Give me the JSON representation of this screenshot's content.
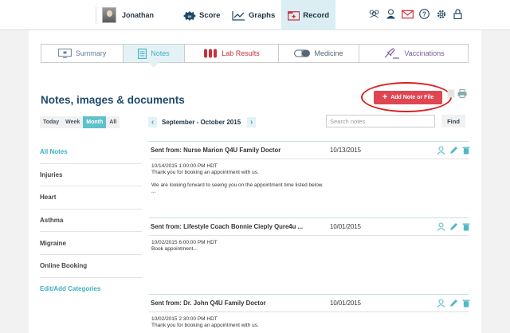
{
  "header": {
    "user_name": "Jonathan",
    "nav": [
      {
        "label": "Score",
        "icon": "score-badge-icon"
      },
      {
        "label": "Graphs",
        "icon": "line-chart-icon"
      },
      {
        "label": "Record",
        "icon": "record-folder-icon"
      }
    ],
    "active_nav": "Record",
    "right_icons": [
      "group-icon",
      "person-icon",
      "mail-icon",
      "help-icon",
      "gear-icon",
      "lock-icon"
    ]
  },
  "tabs": [
    {
      "label": "Summary",
      "icon": "summary-monitor-icon",
      "color": "#6a7f99"
    },
    {
      "label": "Notes",
      "icon": "notes-document-icon",
      "color": "#3fb0c0"
    },
    {
      "label": "Lab Results",
      "icon": "test-tubes-icon",
      "color": "#c8323c"
    },
    {
      "label": "Medicine",
      "icon": "pill-icon",
      "color": "#556677"
    },
    {
      "label": "Vaccinations",
      "icon": "syringe-icon",
      "color": "#7a5aa0"
    }
  ],
  "active_tab": "Notes",
  "page": {
    "title": "Notes, images & documents",
    "add_button": "Add Note or File"
  },
  "filters": {
    "periods": [
      "Today",
      "Week",
      "Month",
      "All"
    ],
    "active_period": "Month",
    "range_label": "September - October 2015",
    "search_placeholder": "Search notes",
    "find_label": "Find"
  },
  "sidebar": {
    "categories": [
      {
        "label": "All Notes",
        "style": "active"
      },
      {
        "label": "Injuries",
        "style": ""
      },
      {
        "label": "Heart",
        "style": ""
      },
      {
        "label": "Asthma",
        "style": ""
      },
      {
        "label": "Migraine",
        "style": ""
      },
      {
        "label": "Online Booking",
        "style": ""
      },
      {
        "label": "Edit/Add Categories",
        "style": "link"
      }
    ]
  },
  "notes": [
    {
      "from": "Sent from: Nurse Marion Q4U Family Doctor",
      "date": "10/13/2015",
      "body": [
        "10/14/2015 1:00:00 PM HDT",
        "Thank you for booking an appointment with us.",
        "We are looking forward to seeing you on the appointment time listed below.",
        "..."
      ]
    },
    {
      "from": "Sent from: Lifestyle Coach Bonnie Cieply Qure4u ...",
      "date": "10/01/2015",
      "body": [
        "10/02/2015 6:00:00 PM HDT",
        "Book appointment..."
      ]
    },
    {
      "from": "Sent from: Dr. John Q4U Family Doctor",
      "date": "10/01/2015",
      "body": [
        "10/02/2015 2:30:00 PM HDT",
        "Thank you for booking an appointment with us."
      ]
    }
  ],
  "colors": {
    "accent": "#3fb0c0",
    "title": "#1f4a6a",
    "add_button": "#e04550",
    "highlight_ring": "#d82020"
  }
}
